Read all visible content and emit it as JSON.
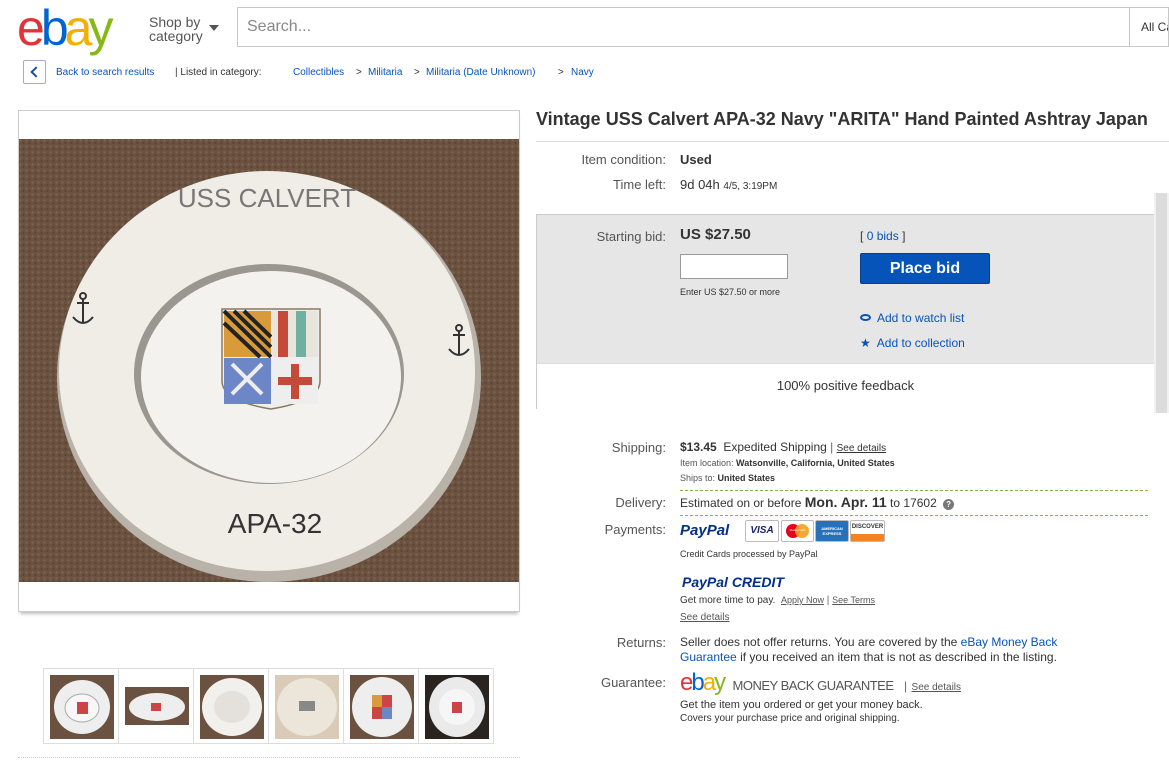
{
  "header": {
    "logo": [
      "e",
      "b",
      "a",
      "y"
    ],
    "logo_colors": [
      "#e53238",
      "#0064d2",
      "#f5af02",
      "#86b817"
    ],
    "shop_by_line1": "Shop by",
    "shop_by_line2": "category",
    "search_placeholder": "Search...",
    "all_categories": "All Ca"
  },
  "breadcrumb": {
    "back": "Back to search results",
    "listed_in": "| Listed in category:",
    "items": [
      "Collectibles",
      ">",
      "Militaria",
      ">",
      "Militaria (Date Unknown)",
      ">",
      "Navy"
    ]
  },
  "photo": {
    "top_text": "USS CALVERT",
    "bottom_text": "APA-32"
  },
  "item": {
    "title": "Vintage USS Calvert APA-32 Navy \"ARITA\" Hand Painted Ashtray Japan",
    "condition_label": "Item condition:",
    "condition_value": "Used",
    "time_left_label": "Time left:",
    "time_left_value": "9d 04h",
    "time_left_date": "4/5, 3:19PM"
  },
  "bid": {
    "starting_label": "Starting bid:",
    "price": "US $27.50",
    "bids_open": "[",
    "bids_link": "0 bids",
    "bids_close": "]",
    "input_hint": "Enter US $27.50 or more",
    "place_bid": "Place bid",
    "watch": "Add to watch list",
    "collection": "Add to collection",
    "feedback": "100% positive feedback"
  },
  "shipping": {
    "label": "Shipping:",
    "price": "$13.45",
    "method": "Expedited Shipping",
    "sep": "|",
    "see_details": "See details",
    "location_label": "Item location:",
    "location": "Watsonville, California, United States",
    "ships_to_label": "Ships to:",
    "ships_to": "United States"
  },
  "delivery": {
    "label": "Delivery:",
    "prefix": "Estimated on or before",
    "date": "Mon. Apr. 11",
    "to": "to 17602",
    "help": "?"
  },
  "payments": {
    "label": "Payments:",
    "paypal": "PayPal",
    "cards": [
      "VISA",
      "MasterCard",
      "AMERICAN EXPRESS",
      "DISCOVER"
    ],
    "card_note": "Credit Cards processed by PayPal",
    "credit_brand": "PayPal CREDIT",
    "more_time": "Get more time to pay.",
    "apply_now": "Apply Now",
    "sep": "|",
    "see_terms": "See Terms",
    "see_details": "See details"
  },
  "returns": {
    "label": "Returns:",
    "text1": "Seller does not offer returns. You are covered by the",
    "link1": "eBay Money Back",
    "link2": "Guarantee",
    "text2": "if you received an item that is not as described in the listing."
  },
  "guarantee": {
    "label": "Guarantee:",
    "brand": "MONEY BACK GUARANTEE",
    "sep": "|",
    "see_details": "See details",
    "line1": "Get the item you ordered or get your money back.",
    "line2": "Covers your purchase price and original shipping."
  }
}
